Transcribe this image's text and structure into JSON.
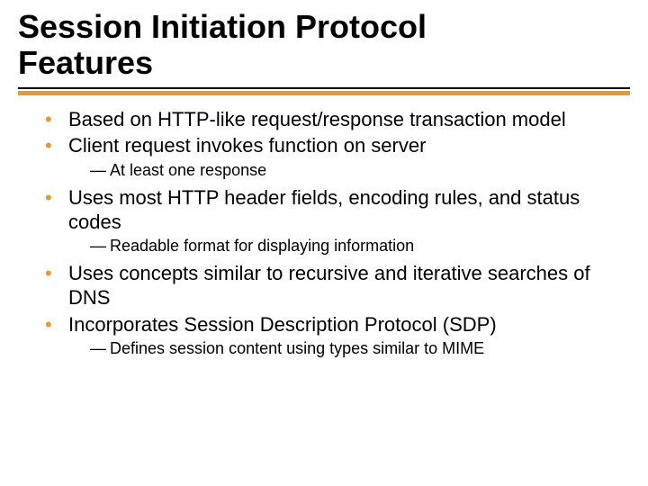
{
  "title_line1": "Session Initiation Protocol",
  "title_line2": "Features",
  "bullets": {
    "b0": "Based on HTTP-like request/response transaction model",
    "b1": "Client request invokes function on server",
    "b1_sub0": "At least one response",
    "b2": "Uses most HTTP header fields, encoding rules, and status codes",
    "b2_sub0": "Readable format for displaying information",
    "b3": "Uses concepts similar to recursive and iterative searches of DNS",
    "b4": "Incorporates Session Description Protocol (SDP)",
    "b4_sub0": "Defines session content using types similar to MIME"
  },
  "colors": {
    "accent": "#E59A2C"
  }
}
